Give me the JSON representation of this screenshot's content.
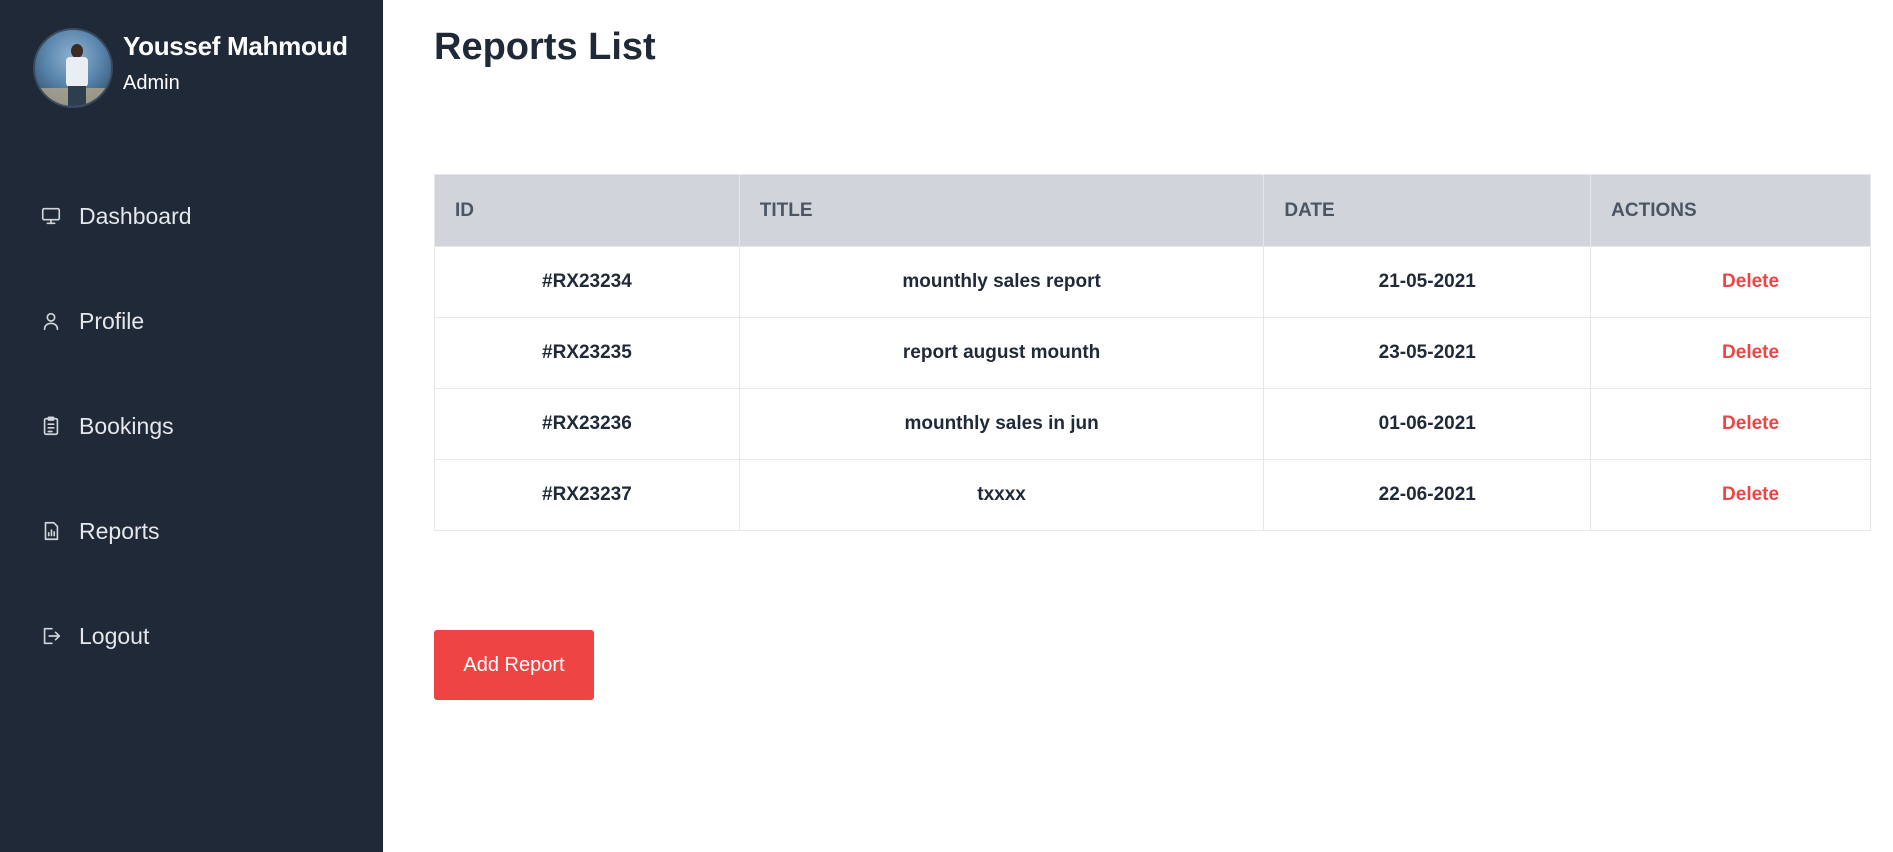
{
  "user": {
    "name": "Youssef Mahmoud",
    "role": "Admin"
  },
  "sidebar": {
    "items": [
      {
        "label": "Dashboard",
        "icon": "monitor-icon"
      },
      {
        "label": "Profile",
        "icon": "user-icon"
      },
      {
        "label": "Bookings",
        "icon": "clipboard-icon"
      },
      {
        "label": "Reports",
        "icon": "report-file-icon"
      },
      {
        "label": "Logout",
        "icon": "logout-icon"
      }
    ]
  },
  "page": {
    "title": "Reports List"
  },
  "table": {
    "headers": [
      "ID",
      "TITLE",
      "DATE",
      "ACTIONS"
    ],
    "rows": [
      {
        "id": "#RX23234",
        "title": "mounthly sales report",
        "date": "21-05-2021",
        "action": "Delete"
      },
      {
        "id": "#RX23235",
        "title": "report august mounth",
        "date": "23-05-2021",
        "action": "Delete"
      },
      {
        "id": "#RX23236",
        "title": "mounthly sales in jun",
        "date": "01-06-2021",
        "action": "Delete"
      },
      {
        "id": "#RX23237",
        "title": "txxxx",
        "date": "22-06-2021",
        "action": "Delete"
      }
    ]
  },
  "buttons": {
    "add_report": "Add Report"
  },
  "colors": {
    "sidebar_bg": "#1f2937",
    "accent": "#ef4444",
    "table_header_bg": "#d1d5db"
  }
}
